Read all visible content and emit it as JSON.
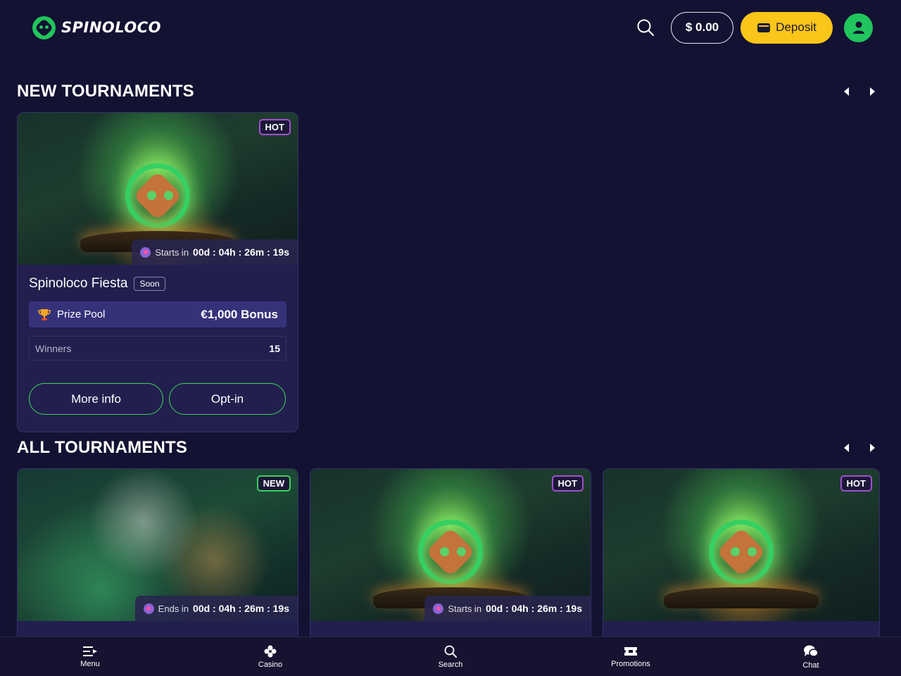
{
  "header": {
    "logo_text": "SPINOLOCO",
    "balance": "$ 0.00",
    "deposit_label": "Deposit"
  },
  "new_tournaments": {
    "title": "NEW TOURNAMENTS",
    "cards": [
      {
        "badge": "HOT",
        "timer_label": "Starts in",
        "timer_value": "00d : 04h : 26m : 19s",
        "title": "Spinoloco Fiesta",
        "tag": "Soon",
        "prize_label": "Prize Pool",
        "prize_value": "€1,000 Bonus",
        "winners_label": "Winners",
        "winners_value": "15",
        "more_info_label": "More info",
        "optin_label": "Opt-in"
      }
    ]
  },
  "all_tournaments": {
    "title": "ALL TOURNAMENTS",
    "cards": [
      {
        "badge": "NEW",
        "timer_label": "Ends in",
        "timer_value": "00d : 04h : 26m : 19s"
      },
      {
        "badge": "HOT",
        "timer_label": "Starts in",
        "timer_value": "00d : 04h : 26m : 19s"
      },
      {
        "badge": "HOT"
      }
    ]
  },
  "bottom_nav": {
    "items": [
      {
        "label": "Menu",
        "icon": "menu-icon"
      },
      {
        "label": "Casino",
        "icon": "clover-icon"
      },
      {
        "label": "Search",
        "icon": "search-icon"
      },
      {
        "label": "Promotions",
        "icon": "ticket-icon"
      },
      {
        "label": "Chat",
        "icon": "chat-icon"
      }
    ]
  },
  "colors": {
    "background": "#141232",
    "accent_green": "#21c55d",
    "deposit_yellow": "#fbc51a",
    "card_bg": "#221f4e",
    "prize_row_bg": "#36327a"
  }
}
